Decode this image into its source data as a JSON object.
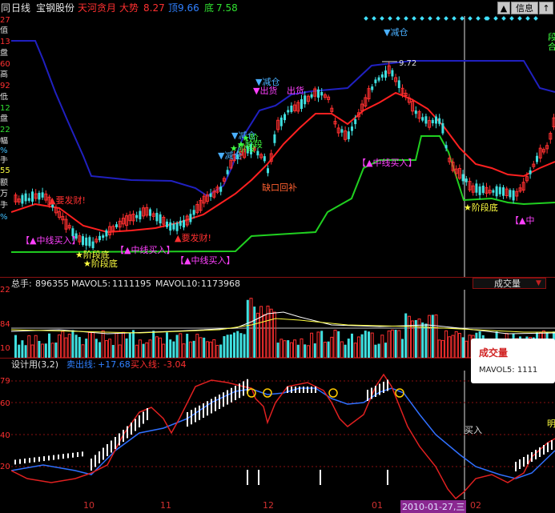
{
  "header": {
    "period": "日线",
    "stock_name": "宝钢股份",
    "indicator_name": "天河贪月",
    "trend_label": "大势",
    "trend_value": "8.27",
    "top_label": "顶",
    "top_value": "9.66",
    "bottom_label": "底",
    "bottom_value": "7.58",
    "left_glyph": "同"
  },
  "toolbar": {
    "button1": "▲",
    "button2": "信息",
    "button3": "↑"
  },
  "left_axis": [
    "27",
    "值",
    "13",
    "盘",
    "60",
    "高",
    "92",
    "低",
    "12",
    "盘",
    "22",
    "幅",
    "%",
    "手",
    "55",
    "额",
    "万",
    "手",
    "%"
  ],
  "main_chart": {
    "price_label": "9.72",
    "annotations": [
      {
        "text": "▼减仓",
        "color": "#4ab0ff"
      },
      {
        "text": "▼减仓",
        "color": "#4ab0ff"
      },
      {
        "text": "▼出货",
        "color": "#ff40ff"
      },
      {
        "text": "▼减仓",
        "color": "#4ab0ff"
      },
      {
        "text": "▼减仓",
        "color": "#4ab0ff"
      },
      {
        "text": "★阶段底",
        "color": "#ffff40"
      },
      {
        "text": "★阶段底",
        "color": "#ffff40"
      },
      {
        "text": "★阶段底",
        "color": "#ffff40"
      },
      {
        "text": "▲要发财!",
        "color": "#ff3030"
      },
      {
        "text": "▲要发财!",
        "color": "#ff3030"
      },
      {
        "text": "【▲中线买入】",
        "color": "#ff40ff"
      },
      {
        "text": "【▲中线买入】",
        "color": "#ff40ff"
      },
      {
        "text": "【▲中线买入】",
        "color": "#ff40ff"
      },
      {
        "text": "【▲中线买入】",
        "color": "#ff40ff"
      },
      {
        "text": "【▲中",
        "color": "#ff40ff"
      },
      {
        "text": "缺口回补",
        "color": "#ff6030"
      },
      {
        "text": "★阶段",
        "color": "#40ff40"
      },
      {
        "text": "★阶段",
        "color": "#40ff40"
      },
      {
        "text": "★阶",
        "color": "#40ff40"
      },
      {
        "text": "出货",
        "color": "#ff40ff"
      },
      {
        "text": "段",
        "color": "#40ff40"
      },
      {
        "text": "合",
        "color": "#40ff40"
      }
    ]
  },
  "volume_panel": {
    "label_total": "总手:",
    "total_value": "896355",
    "ma5_label": "MAVOL5:",
    "ma5_value": "1111195",
    "ma10_label": "MAVOL10:",
    "ma10_value": "1173968",
    "selector_value": "成交量",
    "axis_values": [
      "22",
      "84",
      "10"
    ]
  },
  "tooltip": {
    "title": "成交量",
    "line": "MAVOL5: 1111"
  },
  "indicator_panel": {
    "name": "设计用(3,2)",
    "sell_label": "卖出线:",
    "sell_value": "+17.68",
    "buy_label": "买入线:",
    "buy_value": "-3.04",
    "axis_values": [
      "79",
      "60",
      "40",
      "20"
    ],
    "annotation_buy": "买入",
    "annotation_ming": "明"
  },
  "x_axis": {
    "labels": [
      "10",
      "11",
      "12",
      "01",
      "02"
    ],
    "current_date": "2010-01-27,三"
  },
  "colors": {
    "up": "#ff3030",
    "down": "#40e0e0",
    "ma_red": "#ff2020",
    "line_blue": "#2020c0",
    "line_green": "#20d020",
    "grid": "#8a1010",
    "text_white": "#e0e0e0",
    "text_red": "#ff3030",
    "text_yellow": "#ffff40",
    "text_cyan": "#40e0ff"
  }
}
